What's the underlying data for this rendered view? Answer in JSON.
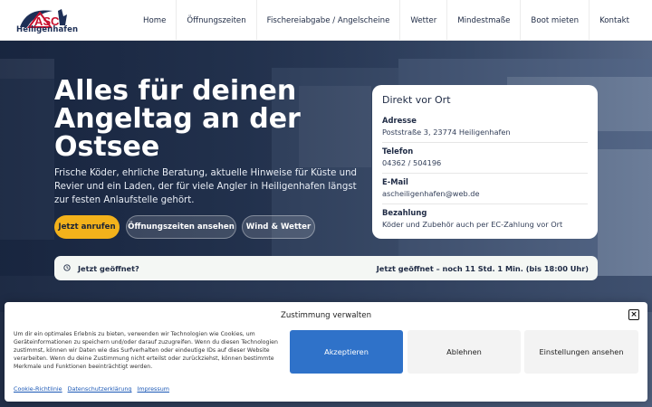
{
  "brand": {
    "logo_letters": "ASC",
    "name": "Heiligenhafen"
  },
  "nav": {
    "items": [
      {
        "label": "Home"
      },
      {
        "label": "Öffnungszeiten"
      },
      {
        "label": "Fischereiabgabe / Angelscheine"
      },
      {
        "label": "Wetter"
      },
      {
        "label": "Mindestmaße"
      },
      {
        "label": "Boot mieten"
      },
      {
        "label": "Kontakt"
      }
    ]
  },
  "hero": {
    "title": "Alles für deinen Angeltag an der Ostsee",
    "text": "Frische Köder, ehrliche Beratung, aktuelle Hinweise für Küste und Revier und ein Laden, der für viele Angler in Heiligenhafen längst zur festen Anlaufstelle gehört.",
    "buttons": {
      "call": "Jetzt anrufen",
      "hours": "Öffnungszeiten ansehen",
      "wind": "Wind & Wetter"
    }
  },
  "card": {
    "title": "Direkt vor Ort",
    "rows": [
      {
        "label": "Adresse",
        "value": "Poststraße 3, 23774 Heiligenhafen"
      },
      {
        "label": "Telefon",
        "value": "04362 / 504196"
      },
      {
        "label": "E-Mail",
        "value": "ascheiligenhafen@web.de"
      },
      {
        "label": "Bezahlung",
        "value": "Köder und Zubehör auch per EC-Zahlung vor Ort"
      }
    ]
  },
  "status": {
    "icon": "clock-icon",
    "question": "Jetzt geöffnet?",
    "answer": "Jetzt geöffnet – noch 11 Std. 1 Min. (bis 18:00 Uhr)"
  },
  "consent": {
    "title": "Zustimmung verwalten",
    "text": "Um dir ein optimales Erlebnis zu bieten, verwenden wir Technologien wie Cookies, um Geräteinformationen zu speichern und/oder darauf zuzugreifen. Wenn du diesen Technologien zustimmst, können wir Daten wie das Surfverhalten oder eindeutige IDs auf dieser Website verarbeiten. Wenn du deine Zustimmung nicht erteilst oder zurückziehst, können bestimmte Merkmale und Funktionen beeinträchtigt werden.",
    "accept": "Akzeptieren",
    "decline": "Ablehnen",
    "settings": "Einstellungen ansehen",
    "links": [
      "Cookie-Richtlinie",
      "Datenschutzerklärung",
      "Impressum"
    ]
  },
  "colors": {
    "accent_yellow": "#f3b21b",
    "accept_blue": "#2f72c9",
    "navy": "#1e2a44"
  }
}
